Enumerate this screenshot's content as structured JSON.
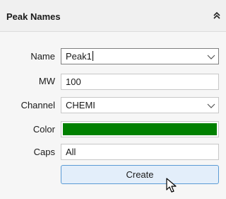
{
  "panel": {
    "title": "Peak Names",
    "collapse_icon": "double-chevron-up-icon"
  },
  "form": {
    "name": {
      "label": "Name",
      "value": "Peak1"
    },
    "mw": {
      "label": "MW",
      "value": "100"
    },
    "channel": {
      "label": "Channel",
      "value": "CHEMI"
    },
    "color": {
      "label": "Color",
      "value": "#008000"
    },
    "caps": {
      "label": "Caps",
      "value": "All"
    }
  },
  "create_label": "Create",
  "colors": {
    "accent_border": "#5b9bd5",
    "button_fill": "#e3eefa"
  }
}
